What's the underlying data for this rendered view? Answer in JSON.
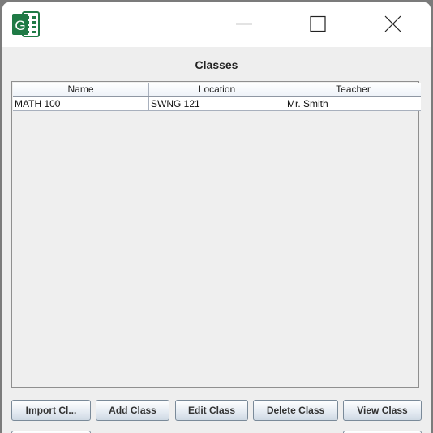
{
  "window": {
    "title_icon": "spreadsheet-app-icon",
    "controls": {
      "minimize": "minimize-icon",
      "maximize": "maximize-icon",
      "close": "close-icon"
    }
  },
  "main": {
    "title": "Classes",
    "table": {
      "columns": [
        "Name",
        "Location",
        "Teacher"
      ],
      "rows": [
        {
          "name": "MATH 100",
          "location": "SWNG 121",
          "teacher": "Mr. Smith"
        }
      ]
    }
  },
  "buttons": {
    "import": "Import Cl...",
    "add": "Add Class",
    "edit": "Edit Class",
    "delete": "Delete Class",
    "view": "View Class"
  },
  "colors": {
    "app_icon_green": "#1f7a45",
    "window_bg": "#eeeeee",
    "titlebar_bg": "#ffffff"
  }
}
